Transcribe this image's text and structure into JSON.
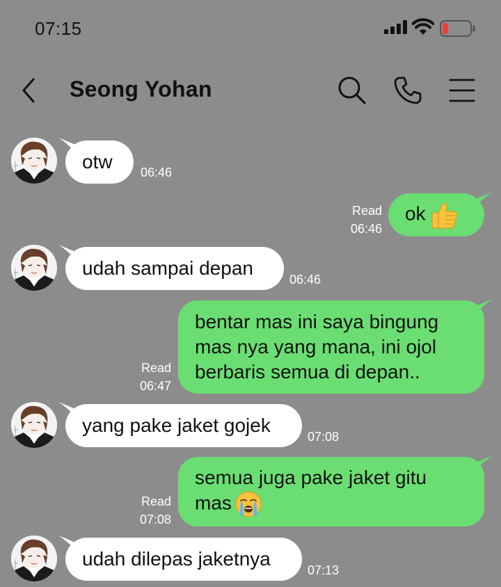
{
  "status_bar": {
    "time": "07:15"
  },
  "header": {
    "contact_name": "Seong Yohan"
  },
  "messages": [
    {
      "id": "m1",
      "direction": "in",
      "lines": [
        "otw"
      ],
      "time": "06:46"
    },
    {
      "id": "m2",
      "direction": "out",
      "lines": [
        "ok"
      ],
      "emoji": "thumbs-up-emoji",
      "read_label": "Read",
      "time": "06:46"
    },
    {
      "id": "m3",
      "direction": "in",
      "lines": [
        "udah sampai depan"
      ],
      "time": "06:46"
    },
    {
      "id": "m4",
      "direction": "out",
      "lines": [
        "bentar mas ini saya bingung",
        "mas nya yang mana, ini ojol",
        "berbaris semua di depan.."
      ],
      "read_label": "Read",
      "time": "06:47"
    },
    {
      "id": "m5",
      "direction": "in",
      "lines": [
        "yang pake jaket gojek"
      ],
      "time": "07:08"
    },
    {
      "id": "m6",
      "direction": "out",
      "lines": [
        "semua juga pake jaket gitu",
        "mas"
      ],
      "emoji": "loudly-crying-emoji",
      "read_label": "Read",
      "time": "07:08"
    },
    {
      "id": "m7",
      "direction": "in",
      "lines": [
        "udah dilepas jaketnya"
      ],
      "time": "07:13"
    }
  ],
  "colors": {
    "background": "#8c8c8c",
    "incoming_bubble": "#ffffff",
    "outgoing_bubble": "#6ade72",
    "battery_low": "#e8413a"
  },
  "icons": [
    "back-chevron-icon",
    "search-icon",
    "phone-icon",
    "menu-icon",
    "signal-icon",
    "wifi-icon",
    "battery-icon"
  ]
}
